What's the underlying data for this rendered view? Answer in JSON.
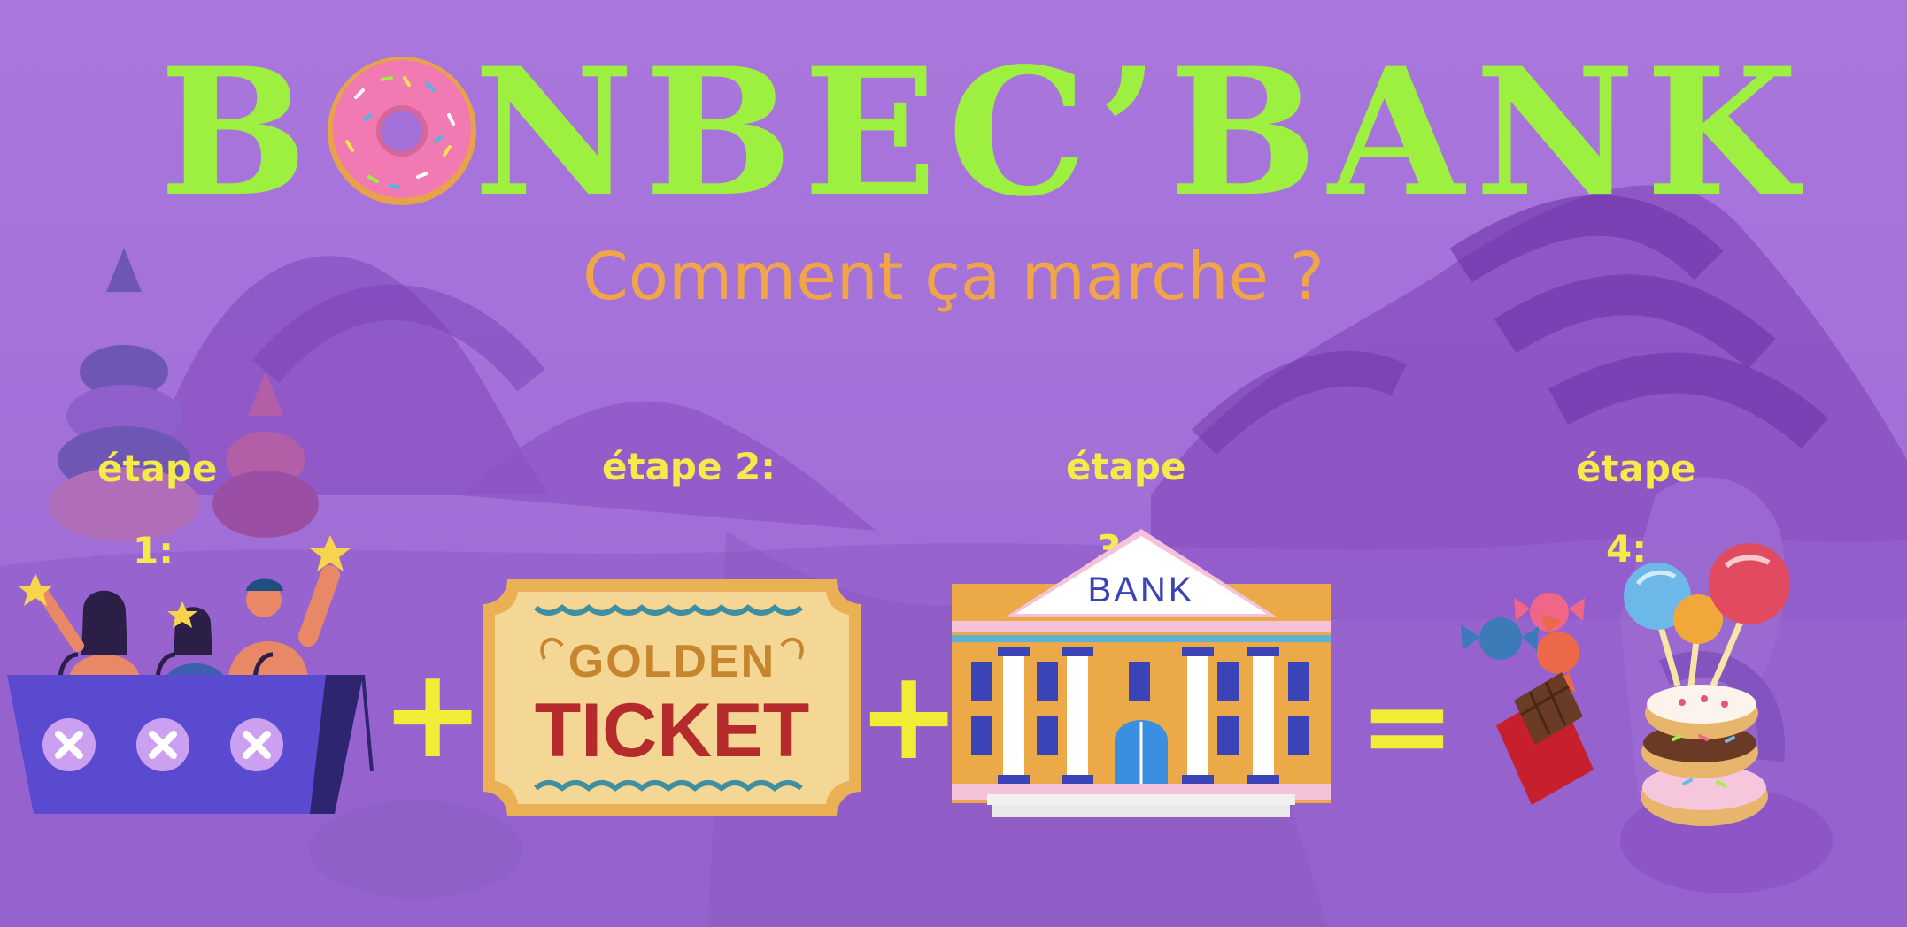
{
  "title": {
    "part1": "B",
    "part2": "NBEC’BANK"
  },
  "subtitle": "Comment ça marche ?",
  "steps": [
    {
      "word": "étape",
      "num": "1:"
    },
    {
      "word": "étape 2:",
      "num": ""
    },
    {
      "word": "étape",
      "num": "3:"
    },
    {
      "word": "étape",
      "num": "4:"
    }
  ],
  "operators": {
    "plus1": "+",
    "plus2": "+",
    "equals": "="
  },
  "ticket": {
    "line1": "GOLDEN",
    "line2": "TICKET"
  },
  "bank": {
    "sign": "BANK"
  },
  "colors": {
    "background": "#a371d8",
    "title": "#9df03f",
    "subtitle": "#f0a548",
    "labels": "#f4ea4a"
  }
}
